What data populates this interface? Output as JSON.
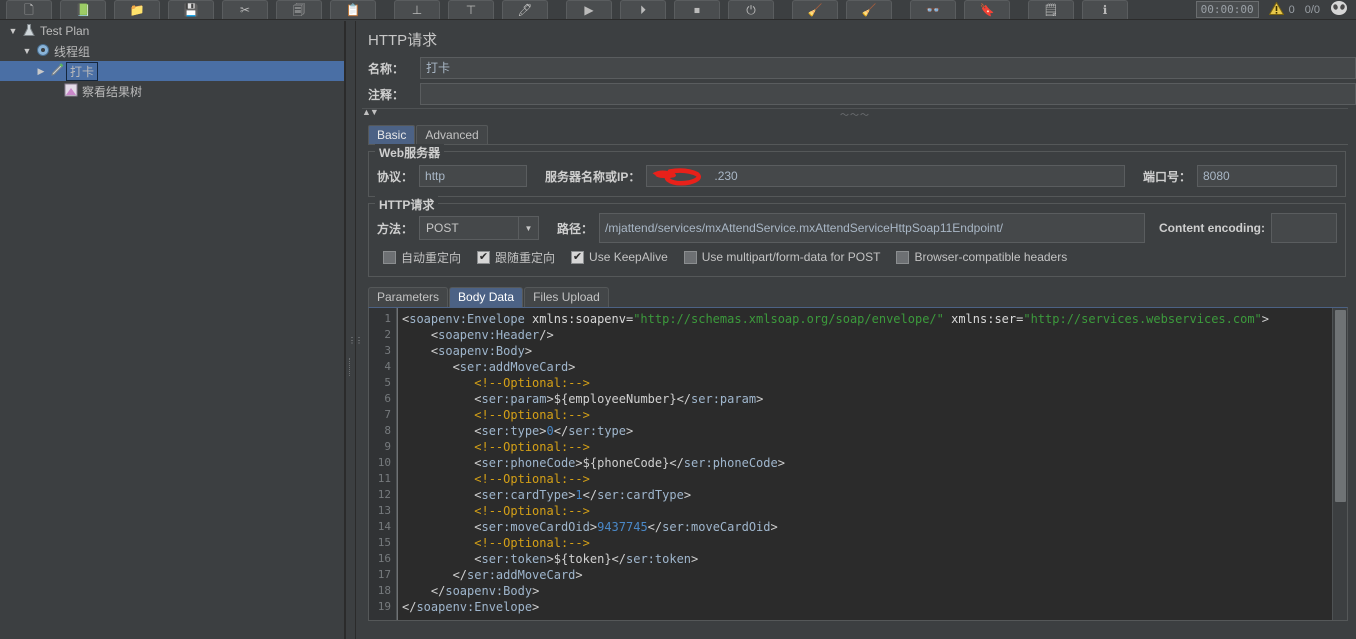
{
  "toolbar": {
    "buttons": [
      {
        "name": "new",
        "glyph": "🗋",
        "label": "New"
      },
      {
        "name": "templates",
        "glyph": "📗",
        "label": "Templates"
      },
      {
        "name": "open",
        "glyph": "📁",
        "label": "Open"
      },
      {
        "name": "save",
        "glyph": "💾",
        "label": "Save Test Plan"
      },
      {
        "name": "cut",
        "glyph": "✂",
        "label": "Cut"
      },
      {
        "name": "copy",
        "glyph": "🗐",
        "label": "Copy"
      },
      {
        "name": "paste",
        "glyph": "📋",
        "label": "Paste"
      },
      {
        "name": "expand-all",
        "glyph": "⊥",
        "label": "Expand All"
      },
      {
        "name": "collapse-all",
        "glyph": "⊤",
        "label": "Collapse All"
      },
      {
        "name": "toggle",
        "glyph": "🖊",
        "label": "Toggle"
      },
      {
        "name": "start",
        "glyph": "▶",
        "label": "Start"
      },
      {
        "name": "start-no-pauses",
        "glyph": "⏵",
        "label": "Start no pauses"
      },
      {
        "name": "stop",
        "glyph": "⏹",
        "label": "Stop"
      },
      {
        "name": "shutdown",
        "glyph": "⏻",
        "label": "Shutdown"
      },
      {
        "name": "clear",
        "glyph": "🧹",
        "label": "Clear"
      },
      {
        "name": "clear-all",
        "glyph": "🧹",
        "label": "Clear All"
      },
      {
        "name": "search",
        "glyph": "👓",
        "label": "Search"
      },
      {
        "name": "reset-search",
        "glyph": "🔖",
        "label": "Reset Search"
      },
      {
        "name": "function-helper",
        "glyph": "🗒",
        "label": "Function Helper Dialog"
      },
      {
        "name": "help",
        "glyph": "ℹ",
        "label": "Help"
      }
    ],
    "status": {
      "timer": "00:00:00",
      "warning_icon": "warning-triangle-icon",
      "error_count": "0",
      "thread_count": "0/0",
      "alien_icon": "alien-icon"
    }
  },
  "tree": {
    "nodes": [
      {
        "name": "test-plan",
        "toggle": "▼",
        "icon": "flask-icon",
        "label": "Test Plan",
        "indent": 0,
        "selected": false
      },
      {
        "name": "thread-group",
        "toggle": "▼",
        "icon": "gear-icon",
        "label": "线程组",
        "indent": 1,
        "selected": false
      },
      {
        "name": "http-sampler",
        "toggle": "▶",
        "icon": "pencil-icon",
        "label": "打卡",
        "indent": 2,
        "selected": true
      },
      {
        "name": "view-results-tree",
        "toggle": "",
        "icon": "chart-icon",
        "label": "察看结果树",
        "indent": 3,
        "selected": false
      }
    ]
  },
  "panel": {
    "title": "HTTP请求",
    "name_label": "名称：",
    "name_value": "打卡",
    "comment_label": "注释：",
    "comment_value": "",
    "tabs": [
      {
        "name": "basic",
        "label": "Basic",
        "active": true
      },
      {
        "name": "advanced",
        "label": "Advanced",
        "active": false
      }
    ],
    "web_server": {
      "legend": "Web服务器",
      "protocol_label": "协议：",
      "protocol_value": "http",
      "server_label": "服务器名称或IP：",
      "server_value": ".230",
      "server_redacted": true,
      "port_label": "端口号：",
      "port_value": "8080"
    },
    "http_request": {
      "legend": "HTTP请求",
      "method_label": "方法：",
      "method_value": "POST",
      "path_label": "路径：",
      "path_value": "/mjattend/services/mxAttendService.mxAttendServiceHttpSoap11Endpoint/",
      "content_encoding_label": "Content encoding:",
      "content_encoding_value": "",
      "checkboxes": [
        {
          "name": "auto-redirect",
          "label": "自动重定向",
          "checked": false
        },
        {
          "name": "follow-redirects",
          "label": "跟随重定向",
          "checked": true
        },
        {
          "name": "use-keepalive",
          "label": "Use KeepAlive",
          "checked": true
        },
        {
          "name": "use-multipart",
          "label": "Use multipart/form-data for POST",
          "checked": false
        },
        {
          "name": "browser-compatible-headers",
          "label": "Browser-compatible headers",
          "checked": false
        }
      ],
      "subtabs": [
        {
          "name": "parameters",
          "label": "Parameters",
          "active": false
        },
        {
          "name": "body-data",
          "label": "Body Data",
          "active": true
        },
        {
          "name": "files-upload",
          "label": "Files Upload",
          "active": false
        }
      ]
    },
    "body_data": {
      "line_numbers": [
        "1",
        "2",
        "3",
        "4",
        "5",
        "6",
        "7",
        "8",
        "9",
        "10",
        "11",
        "12",
        "13",
        "14",
        "15",
        "16",
        "17",
        "18",
        "19"
      ],
      "lines": [
        [
          {
            "t": "punc",
            "v": "<"
          },
          {
            "t": "tag",
            "v": "soapenv:Envelope"
          },
          {
            "t": "attr",
            "v": " xmlns:soapenv="
          },
          {
            "t": "str",
            "v": "\"http://schemas.xmlsoap.org/soap/envelope/\""
          },
          {
            "t": "attr",
            "v": " xmlns:ser="
          },
          {
            "t": "str",
            "v": "\"http://services.webservices.com\""
          },
          {
            "t": "punc",
            "v": ">"
          }
        ],
        [
          {
            "t": "punc",
            "v": "    <"
          },
          {
            "t": "tag",
            "v": "soapenv:Header"
          },
          {
            "t": "punc",
            "v": "/>"
          }
        ],
        [
          {
            "t": "punc",
            "v": "    <"
          },
          {
            "t": "tag",
            "v": "soapenv:Body"
          },
          {
            "t": "punc",
            "v": ">"
          }
        ],
        [
          {
            "t": "punc",
            "v": "       <"
          },
          {
            "t": "tag",
            "v": "ser:addMoveCard"
          },
          {
            "t": "punc",
            "v": ">"
          }
        ],
        [
          {
            "t": "com",
            "v": "          <!--Optional:-->"
          }
        ],
        [
          {
            "t": "punc",
            "v": "          <"
          },
          {
            "t": "tag",
            "v": "ser:param"
          },
          {
            "t": "punc",
            "v": ">"
          },
          {
            "t": "var",
            "v": "${employeeNumber}"
          },
          {
            "t": "punc",
            "v": "</"
          },
          {
            "t": "tag",
            "v": "ser:param"
          },
          {
            "t": "punc",
            "v": ">"
          }
        ],
        [
          {
            "t": "com",
            "v": "          <!--Optional:-->"
          }
        ],
        [
          {
            "t": "punc",
            "v": "          <"
          },
          {
            "t": "tag",
            "v": "ser:type"
          },
          {
            "t": "punc",
            "v": ">"
          },
          {
            "t": "num",
            "v": "0"
          },
          {
            "t": "punc",
            "v": "</"
          },
          {
            "t": "tag",
            "v": "ser:type"
          },
          {
            "t": "punc",
            "v": ">"
          }
        ],
        [
          {
            "t": "com",
            "v": "          <!--Optional:-->"
          }
        ],
        [
          {
            "t": "punc",
            "v": "          <"
          },
          {
            "t": "tag",
            "v": "ser:phoneCode"
          },
          {
            "t": "punc",
            "v": ">"
          },
          {
            "t": "var",
            "v": "${phoneCode}"
          },
          {
            "t": "punc",
            "v": "</"
          },
          {
            "t": "tag",
            "v": "ser:phoneCode"
          },
          {
            "t": "punc",
            "v": ">"
          }
        ],
        [
          {
            "t": "com",
            "v": "          <!--Optional:-->"
          }
        ],
        [
          {
            "t": "punc",
            "v": "          <"
          },
          {
            "t": "tag",
            "v": "ser:cardType"
          },
          {
            "t": "punc",
            "v": ">"
          },
          {
            "t": "num",
            "v": "1"
          },
          {
            "t": "punc",
            "v": "</"
          },
          {
            "t": "tag",
            "v": "ser:cardType"
          },
          {
            "t": "punc",
            "v": ">"
          }
        ],
        [
          {
            "t": "com",
            "v": "          <!--Optional:-->"
          }
        ],
        [
          {
            "t": "punc",
            "v": "          <"
          },
          {
            "t": "tag",
            "v": "ser:moveCardOid"
          },
          {
            "t": "punc",
            "v": ">"
          },
          {
            "t": "num",
            "v": "9437745"
          },
          {
            "t": "punc",
            "v": "</"
          },
          {
            "t": "tag",
            "v": "ser:moveCardOid"
          },
          {
            "t": "punc",
            "v": ">"
          }
        ],
        [
          {
            "t": "com",
            "v": "          <!--Optional:-->"
          }
        ],
        [
          {
            "t": "punc",
            "v": "          <"
          },
          {
            "t": "tag",
            "v": "ser:token"
          },
          {
            "t": "punc",
            "v": ">"
          },
          {
            "t": "var",
            "v": "${token}"
          },
          {
            "t": "punc",
            "v": "</"
          },
          {
            "t": "tag",
            "v": "ser:token"
          },
          {
            "t": "punc",
            "v": ">"
          }
        ],
        [
          {
            "t": "punc",
            "v": "       </"
          },
          {
            "t": "tag",
            "v": "ser:addMoveCard"
          },
          {
            "t": "punc",
            "v": ">"
          }
        ],
        [
          {
            "t": "punc",
            "v": "    </"
          },
          {
            "t": "tag",
            "v": "soapenv:Body"
          },
          {
            "t": "punc",
            "v": ">"
          }
        ],
        [
          {
            "t": "punc",
            "v": "</"
          },
          {
            "t": "tag",
            "v": "soapenv:Envelope"
          },
          {
            "t": "punc",
            "v": ">"
          }
        ]
      ]
    }
  },
  "colors": {
    "window_bg": "#3c3f41",
    "editor_bg": "#2b2b2b",
    "selection_blue": "#4a6fa5",
    "active_tab_blue": "#4c6285",
    "text": "#bbbbbb",
    "field_bg": "#45484a",
    "string_green": "#3c9a3c",
    "comment_orange": "#d4a017",
    "tag_blue": "#9fb6cd",
    "number_blue": "#4a88c7",
    "redaction_red": "#e8211a"
  }
}
